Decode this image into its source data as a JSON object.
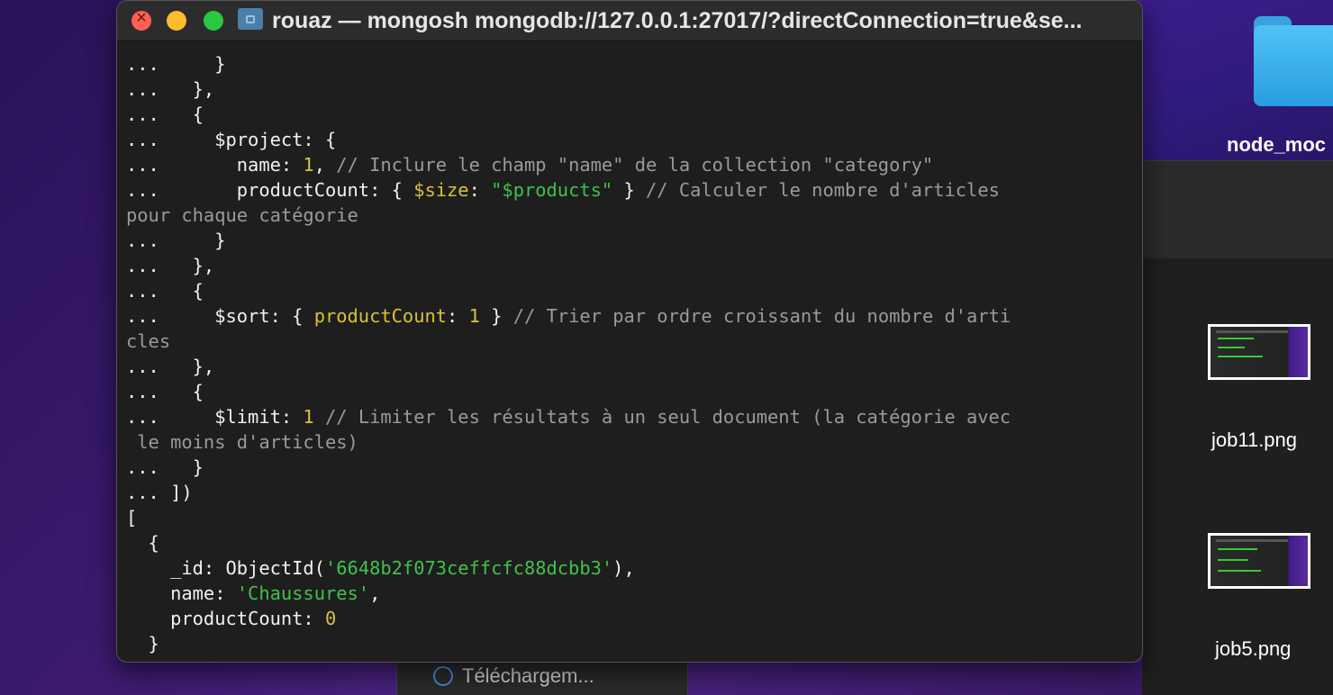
{
  "window": {
    "title": "rouaz — mongosh mongodb://127.0.0.1:27017/?directConnection=true&se..."
  },
  "terminal_lines": [
    [
      {
        "t": "...     }",
        "c": "w"
      }
    ],
    [
      {
        "t": "...   },",
        "c": "w"
      }
    ],
    [
      {
        "t": "...   {",
        "c": "w"
      }
    ],
    [
      {
        "t": "...     $project: {",
        "c": "w"
      }
    ],
    [
      {
        "t": "...       name: ",
        "c": "w"
      },
      {
        "t": "1",
        "c": "y"
      },
      {
        "t": ", ",
        "c": "w"
      },
      {
        "t": "// Inclure le champ \"name\" de la collection \"category\"",
        "c": "c"
      }
    ],
    [
      {
        "t": "...       productCount: { ",
        "c": "w"
      },
      {
        "t": "$size",
        "c": "y"
      },
      {
        "t": ": ",
        "c": "w"
      },
      {
        "t": "\"$products\"",
        "c": "g"
      },
      {
        "t": " } ",
        "c": "w"
      },
      {
        "t": "// Calculer le nombre d'articles",
        "c": "c"
      }
    ],
    [
      {
        "t": "pour chaque catégorie",
        "c": "c"
      }
    ],
    [
      {
        "t": "...     }",
        "c": "w"
      }
    ],
    [
      {
        "t": "...   },",
        "c": "w"
      }
    ],
    [
      {
        "t": "...   {",
        "c": "w"
      }
    ],
    [
      {
        "t": "...     $sort: { ",
        "c": "w"
      },
      {
        "t": "productCount",
        "c": "y"
      },
      {
        "t": ": ",
        "c": "w"
      },
      {
        "t": "1",
        "c": "y"
      },
      {
        "t": " } ",
        "c": "w"
      },
      {
        "t": "// Trier par ordre croissant du nombre d'arti",
        "c": "c"
      }
    ],
    [
      {
        "t": "cles",
        "c": "c"
      }
    ],
    [
      {
        "t": "...   },",
        "c": "w"
      }
    ],
    [
      {
        "t": "...   {",
        "c": "w"
      }
    ],
    [
      {
        "t": "...     $limit: ",
        "c": "w"
      },
      {
        "t": "1",
        "c": "y"
      },
      {
        "t": " ",
        "c": "w"
      },
      {
        "t": "// Limiter les résultats à un seul document (la catégorie avec",
        "c": "c"
      }
    ],
    [
      {
        "t": " le moins d'articles)",
        "c": "c"
      }
    ],
    [
      {
        "t": "...   }",
        "c": "w"
      }
    ],
    [
      {
        "t": "... ])",
        "c": "w"
      }
    ],
    [
      {
        "t": "[",
        "c": "w"
      }
    ],
    [
      {
        "t": "  {",
        "c": "w"
      }
    ],
    [
      {
        "t": "    _id: ObjectId(",
        "c": "w"
      },
      {
        "t": "'6648b2f073ceffcfc88dcbb3'",
        "c": "g"
      },
      {
        "t": "),",
        "c": "w"
      }
    ],
    [
      {
        "t": "    name: ",
        "c": "w"
      },
      {
        "t": "'Chaussures'",
        "c": "g"
      },
      {
        "t": ",",
        "c": "w"
      }
    ],
    [
      {
        "t": "    productCount: ",
        "c": "w"
      },
      {
        "t": "0",
        "c": "y"
      }
    ],
    [
      {
        "t": "  }",
        "c": "w"
      }
    ]
  ],
  "desktop": {
    "folder_label": "node_moc",
    "files": [
      {
        "label": "job11.png"
      },
      {
        "label": "job5.png"
      }
    ],
    "dock_label": "Téléchargem..."
  }
}
